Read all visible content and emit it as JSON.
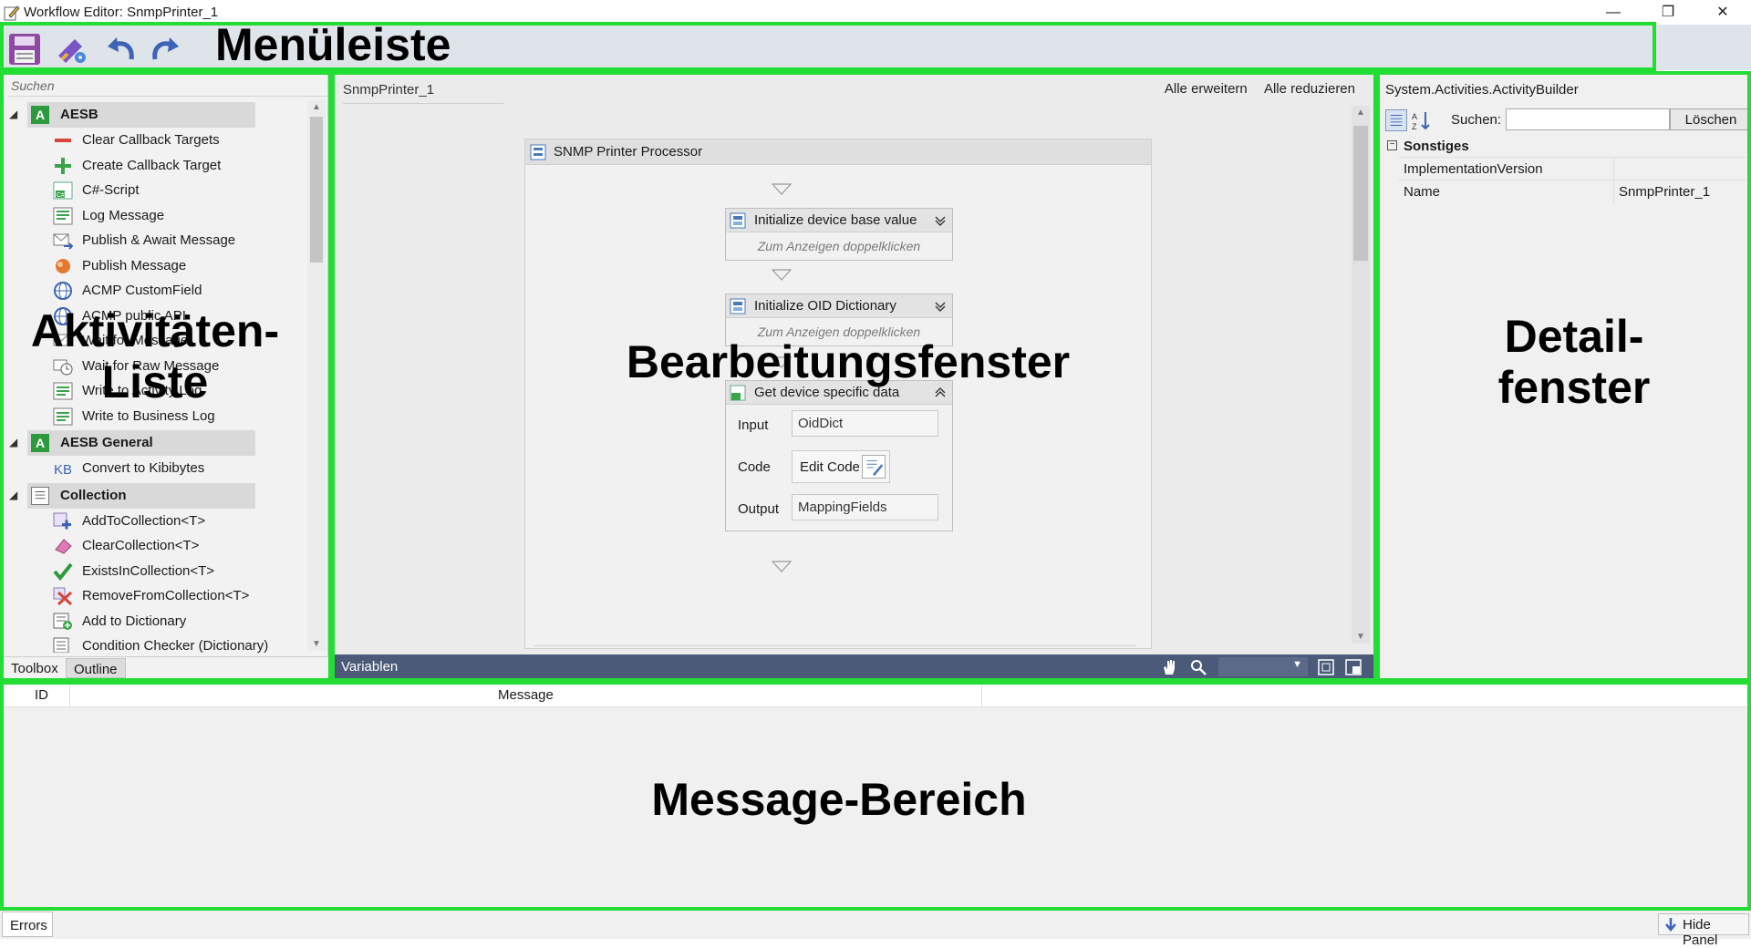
{
  "window": {
    "title": "Workflow Editor: SnmpPrinter_1",
    "minimize": "—",
    "restore": "❐",
    "close": "✕"
  },
  "overlays": {
    "menu": "Menüleiste",
    "activities_line1": "Aktivitäten-",
    "activities_line2": "Liste",
    "editor": "Bearbeitungsfenster",
    "detail_line1": "Detail-",
    "detail_line2": "fenster",
    "messages": "Message-Bereich"
  },
  "toolbar": {
    "icons": [
      "save-icon",
      "settings-tools-icon",
      "undo-icon",
      "redo-icon"
    ]
  },
  "toolbox": {
    "search_placeholder": "Suchen",
    "categories": [
      {
        "label": "AESB",
        "icon": "A",
        "items": [
          {
            "label": "Clear Callback Targets",
            "icon": "minus-red-icon"
          },
          {
            "label": "Create Callback Target",
            "icon": "plus-green-icon"
          },
          {
            "label": "C#-Script",
            "icon": "csharp-script-icon"
          },
          {
            "label": "Log Message",
            "icon": "log-icon"
          },
          {
            "label": "Publish & Await Message",
            "icon": "publish-await-icon"
          },
          {
            "label": "Publish Message",
            "icon": "publish-icon"
          },
          {
            "label": "ACMP CustomField",
            "icon": "globe-icon"
          },
          {
            "label": "ACMP public API",
            "icon": "globe-icon"
          },
          {
            "label": "Wait for Message",
            "icon": "wait-icon"
          },
          {
            "label": "Wait for Raw Message",
            "icon": "wait-clock-icon"
          },
          {
            "label": "Write to Activity Log",
            "icon": "write-log-icon"
          },
          {
            "label": "Write to Business Log",
            "icon": "write-log-icon"
          }
        ]
      },
      {
        "label": "AESB General",
        "icon": "A",
        "items": [
          {
            "label": "Convert to Kibibytes",
            "icon": "kb-icon"
          }
        ]
      },
      {
        "label": "Collection",
        "icon": "list",
        "items": [
          {
            "label": "AddToCollection<T>",
            "icon": "add-collection-icon"
          },
          {
            "label": "ClearCollection<T>",
            "icon": "eraser-icon"
          },
          {
            "label": "ExistsInCollection<T>",
            "icon": "checkmark-icon"
          },
          {
            "label": "RemoveFromCollection<T>",
            "icon": "remove-x-icon"
          },
          {
            "label": "Add to Dictionary",
            "icon": "dictionary-add-icon"
          },
          {
            "label": "Condition Checker (Dictionary)",
            "icon": "dictionary-check-icon"
          }
        ]
      }
    ],
    "tabs": [
      "Toolbox",
      "Outline"
    ]
  },
  "designer": {
    "breadcrumb": "SnmpPrinter_1",
    "expand_all": "Alle erweitern",
    "collapse_all": "Alle reduzieren",
    "sequence_title": "SNMP Printer Processor",
    "activities": [
      {
        "title": "Initialize device base value",
        "hint": "Zum Anzeigen doppelklicken"
      },
      {
        "title": "Initialize OID Dictionary",
        "hint": "Zum Anzeigen doppelklicken"
      },
      {
        "title": "Get device specific data",
        "input_label": "Input",
        "input_value": "OidDict",
        "code_label": "Code",
        "code_button": "Edit Code",
        "output_label": "Output",
        "output_value": "MappingFields"
      }
    ],
    "variables_label": "Variablen"
  },
  "properties": {
    "title": "System.Activities.ActivityBuilder",
    "search_label": "Suchen:",
    "search_value": "",
    "clear_button": "Löschen",
    "category": "Sonstiges",
    "rows": [
      {
        "key": "ImplementationVersion",
        "value": ""
      },
      {
        "key": "Name",
        "value": "SnmpPrinter_1"
      }
    ]
  },
  "messages": {
    "col_id": "ID",
    "col_message": "Message"
  },
  "statusbar": {
    "errors_tab": "Errors",
    "hide_panel": "Hide Panel"
  },
  "colors": {
    "highlight": "#22dd33",
    "variables_bar": "#4a5a78",
    "toolbar_bg": "#dfe3ea"
  }
}
